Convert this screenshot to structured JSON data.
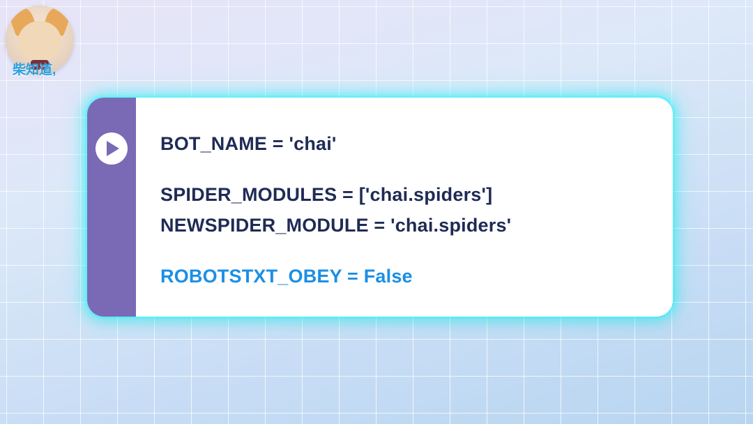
{
  "avatar": {
    "label": "柴知道,"
  },
  "code": {
    "line1": "BOT_NAME = 'chai'",
    "line2": "SPIDER_MODULES = ['chai.spiders']",
    "line3": "NEWSPIDER_MODULE = 'chai.spiders'",
    "line4": "ROBOTSTXT_OBEY = False"
  }
}
